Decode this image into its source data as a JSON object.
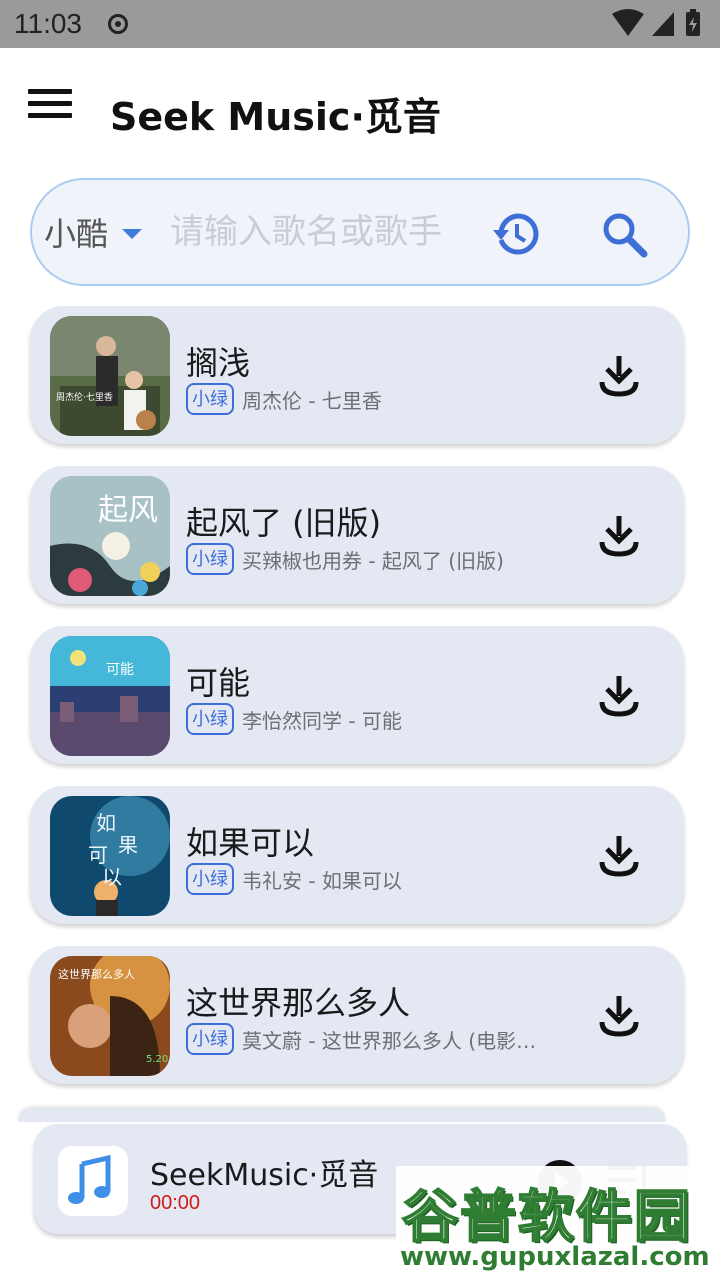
{
  "status_bar": {
    "time": "11:03"
  },
  "app_bar": {
    "title": "Seek Music·觅音"
  },
  "search": {
    "source": "小酷",
    "placeholder": "请输入歌名或歌手"
  },
  "songs": [
    {
      "title": "搁浅",
      "source": "小绿",
      "subtitle": "周杰伦 - 七里香",
      "cover_colors": [
        "#4d5a3a",
        "#8fa27a",
        "#2d2f2a"
      ]
    },
    {
      "title": "起风了 (旧版)",
      "source": "小绿",
      "subtitle": "买辣椒也用券 - 起风了 (旧版)",
      "cover_colors": [
        "#a7c1c4",
        "#2d3a3e",
        "#e05a7a"
      ]
    },
    {
      "title": "可能",
      "source": "小绿",
      "subtitle": "李怡然同学 - 可能",
      "cover_colors": [
        "#2c3f73",
        "#45b7d8",
        "#7b5d7a"
      ]
    },
    {
      "title": "如果可以",
      "source": "小绿",
      "subtitle": "韦礼安 - 如果可以",
      "cover_colors": [
        "#0f4a6e",
        "#4a9dc2",
        "#f0b26a"
      ]
    },
    {
      "title": "这世界那么多人",
      "source": "小绿",
      "subtitle": "莫文蔚 - 这世界那么多人 (电影…",
      "cover_colors": [
        "#8a4a1e",
        "#e8a24a",
        "#3b2414"
      ]
    }
  ],
  "player": {
    "title": "SeekMusic·觅音",
    "time": "00:00"
  },
  "watermark": {
    "main": "谷普软件园",
    "url": "www.gupuxlazal.com"
  },
  "colors": {
    "accent": "#3d6fd6",
    "card_bg": "#e3e8f2",
    "time_red": "#d11b1b"
  }
}
